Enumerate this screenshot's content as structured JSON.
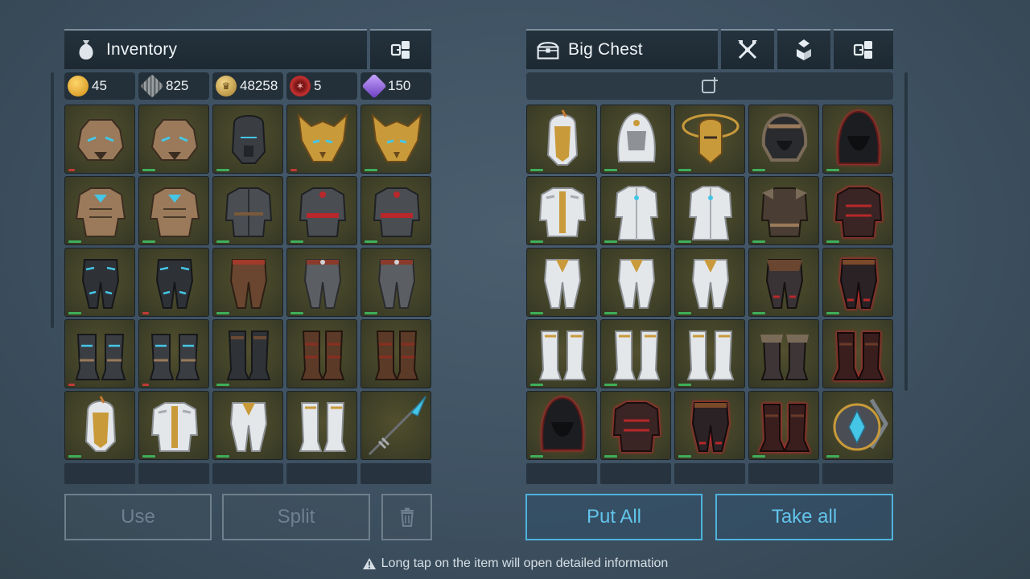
{
  "inventory": {
    "title": "Inventory",
    "currencies": [
      {
        "icon": "gold-coin-icon",
        "value": "45",
        "color": "#e0a526"
      },
      {
        "icon": "iron-ingot-icon",
        "value": "825",
        "color": "#8b8f91"
      },
      {
        "icon": "crown-coin-icon",
        "value": "48258",
        "color": "#c9a34a"
      },
      {
        "icon": "red-emblem-icon",
        "value": "5",
        "color": "#c23030"
      },
      {
        "icon": "purple-crystal-icon",
        "value": "150",
        "color": "#8c5fd6"
      }
    ],
    "items": [
      {
        "name": "bear-helmet",
        "kind": "helmet-bear",
        "dur": "red"
      },
      {
        "name": "bear-helmet",
        "kind": "helmet-bear",
        "dur": "green"
      },
      {
        "name": "dark-hood-mask",
        "kind": "helmet-dark",
        "dur": "green"
      },
      {
        "name": "golden-wolf-mask",
        "kind": "helmet-wolf",
        "dur": "red"
      },
      {
        "name": "golden-wolf-mask",
        "kind": "helmet-wolf",
        "dur": "green"
      },
      {
        "name": "bear-armor",
        "kind": "armor-bronze",
        "dur": "green"
      },
      {
        "name": "bear-armor",
        "kind": "armor-bronze",
        "dur": "green"
      },
      {
        "name": "leather-jacket",
        "kind": "armor-dark",
        "dur": "green"
      },
      {
        "name": "red-sash-jacket",
        "kind": "armor-red",
        "dur": "green"
      },
      {
        "name": "red-sash-jacket",
        "kind": "armor-red",
        "dur": "green"
      },
      {
        "name": "bear-pants",
        "kind": "pants-dark",
        "dur": "green"
      },
      {
        "name": "bear-pants",
        "kind": "pants-dark",
        "dur": "red"
      },
      {
        "name": "leather-pants",
        "kind": "pants-brown",
        "dur": "green"
      },
      {
        "name": "belted-pants",
        "kind": "pants-grey",
        "dur": "green"
      },
      {
        "name": "belted-pants",
        "kind": "pants-grey",
        "dur": "green"
      },
      {
        "name": "bear-boots",
        "kind": "boots-dark",
        "dur": "red"
      },
      {
        "name": "bear-boots",
        "kind": "boots-dark",
        "dur": "red"
      },
      {
        "name": "dark-boots",
        "kind": "boots-dark2",
        "dur": "green"
      },
      {
        "name": "leather-boots",
        "kind": "boots-brown",
        "dur": "none"
      },
      {
        "name": "leather-boots",
        "kind": "boots-brown",
        "dur": "none"
      },
      {
        "name": "paladin-helmet",
        "kind": "helmet-white",
        "dur": "green"
      },
      {
        "name": "paladin-armor",
        "kind": "armor-white",
        "dur": "green"
      },
      {
        "name": "paladin-pants",
        "kind": "pants-white",
        "dur": "green"
      },
      {
        "name": "paladin-boots",
        "kind": "boots-white",
        "dur": "none"
      },
      {
        "name": "crystal-spear",
        "kind": "spear",
        "dur": "none"
      }
    ],
    "buttons": {
      "use": "Use",
      "split": "Split"
    }
  },
  "chest": {
    "title": "Big Chest",
    "items": [
      {
        "name": "paladin-helmet",
        "kind": "helmet-white",
        "dur": "green"
      },
      {
        "name": "white-hood",
        "kind": "helmet-hood-white",
        "dur": "green"
      },
      {
        "name": "halo-helmet",
        "kind": "helmet-halo",
        "dur": "green"
      },
      {
        "name": "fur-hood",
        "kind": "helmet-furhood",
        "dur": "green"
      },
      {
        "name": "red-hood",
        "kind": "helmet-redhood",
        "dur": "green"
      },
      {
        "name": "paladin-armor",
        "kind": "armor-white",
        "dur": "green"
      },
      {
        "name": "white-robe",
        "kind": "armor-white2",
        "dur": "green"
      },
      {
        "name": "white-coat",
        "kind": "armor-white2",
        "dur": "green"
      },
      {
        "name": "barbarian-armor",
        "kind": "armor-barb",
        "dur": "green"
      },
      {
        "name": "red-barbarian-armor",
        "kind": "armor-redbarb",
        "dur": "green"
      },
      {
        "name": "paladin-pants",
        "kind": "pants-white",
        "dur": "green"
      },
      {
        "name": "white-pants",
        "kind": "pants-white",
        "dur": "green"
      },
      {
        "name": "white-robe-pants",
        "kind": "pants-white",
        "dur": "green"
      },
      {
        "name": "barbarian-pants",
        "kind": "pants-barb",
        "dur": "green"
      },
      {
        "name": "red-barbarian-pants",
        "kind": "pants-red",
        "dur": "green"
      },
      {
        "name": "paladin-boots",
        "kind": "boots-white",
        "dur": "green"
      },
      {
        "name": "gold-paladin-boots",
        "kind": "boots-white",
        "dur": "green"
      },
      {
        "name": "white-boots",
        "kind": "boots-white",
        "dur": "green"
      },
      {
        "name": "fur-boots",
        "kind": "boots-fur",
        "dur": "none"
      },
      {
        "name": "red-boots",
        "kind": "boots-red",
        "dur": "none"
      },
      {
        "name": "red-hood",
        "kind": "helmet-redhood",
        "dur": "green"
      },
      {
        "name": "red-barbarian-armor",
        "kind": "armor-redbarb",
        "dur": "green"
      },
      {
        "name": "red-barbarian-pants",
        "kind": "pants-red",
        "dur": "green"
      },
      {
        "name": "red-boots",
        "kind": "boots-red",
        "dur": "green"
      },
      {
        "name": "crusader-shield",
        "kind": "shield",
        "dur": "green"
      }
    ],
    "buttons": {
      "put_all": "Put All",
      "take_all": "Take all"
    }
  },
  "footer": {
    "hint": "Long tap on the item will open detailed information"
  },
  "colors": {
    "accent": "#4fb2dc",
    "slot": "#4a4a2c",
    "dur_green": "#3fae5a",
    "dur_red": "#c03a36"
  }
}
